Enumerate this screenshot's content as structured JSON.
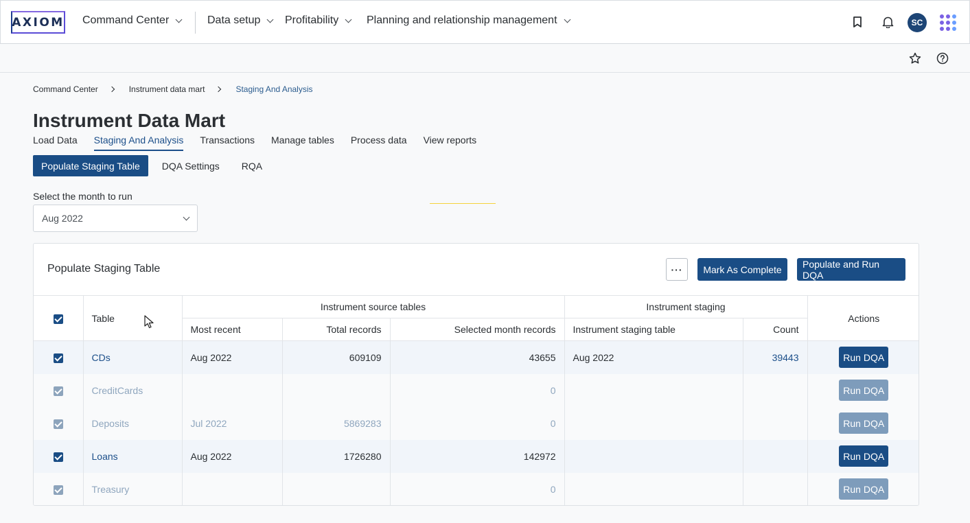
{
  "brand": {
    "logo_text": "AXIOM"
  },
  "nav": {
    "items": [
      {
        "label": "Command Center"
      },
      {
        "label": "Data setup"
      },
      {
        "label": "Profitability"
      },
      {
        "label": "Planning and relationship management"
      }
    ],
    "user_initials": "SC"
  },
  "icons": {
    "bookmark": "bookmark-icon",
    "bell": "bell-icon",
    "apps": "app-grid-icon",
    "star": "star-icon",
    "help": "help-icon"
  },
  "breadcrumb": [
    "Command Center",
    "Instrument data mart",
    "Staging And Analysis"
  ],
  "page": {
    "title": "Instrument Data Mart"
  },
  "tabs": [
    "Load Data",
    "Staging And Analysis",
    "Transactions",
    "Manage tables",
    "Process data",
    "View reports"
  ],
  "active_tab": "Staging And Analysis",
  "subtabs": [
    "Populate Staging Table",
    "DQA Settings",
    "RQA"
  ],
  "active_subtab": "Populate Staging Table",
  "month": {
    "label": "Select the month to run",
    "value": "Aug 2022"
  },
  "card": {
    "title": "Populate Staging Table",
    "more_label": "···",
    "mark_complete": "Mark As Complete",
    "populate_run": "Populate and Run DQA"
  },
  "table": {
    "header_table": "Table",
    "group_source": "Instrument source tables",
    "group_staging": "Instrument staging",
    "header_actions": "Actions",
    "col_most_recent": "Most recent",
    "col_total_records": "Total records",
    "col_selected_month": "Selected month records",
    "col_staging_table": "Instrument staging table",
    "col_count": "Count",
    "action_label": "Run DQA",
    "rows": [
      {
        "name": "CDs",
        "most_recent": "Aug 2022",
        "total": "609109",
        "selected": "43655",
        "staging": "Aug 2022",
        "count": "39443",
        "enabled": true
      },
      {
        "name": "CreditCards",
        "most_recent": "",
        "total": "",
        "selected": "0",
        "staging": "",
        "count": "",
        "enabled": false
      },
      {
        "name": "Deposits",
        "most_recent": "Jul 2022",
        "total": "5869283",
        "selected": "0",
        "staging": "",
        "count": "",
        "enabled": false
      },
      {
        "name": "Loans",
        "most_recent": "Aug 2022",
        "total": "1726280",
        "selected": "142972",
        "staging": "",
        "count": "",
        "enabled": true
      },
      {
        "name": "Treasury",
        "most_recent": "",
        "total": "",
        "selected": "0",
        "staging": "",
        "count": "",
        "enabled": false
      }
    ]
  },
  "colors": {
    "primary": "#1a4d85",
    "accent": "#7b61e4",
    "disabled": "#7e9cbb"
  }
}
